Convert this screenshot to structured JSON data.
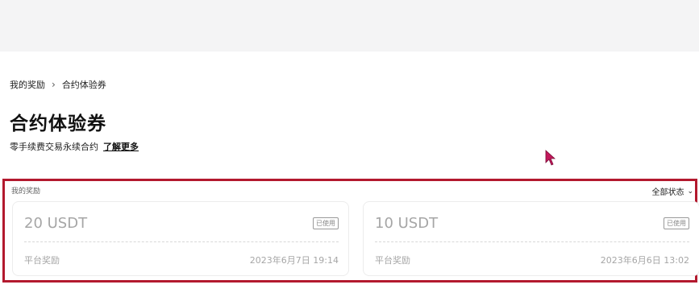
{
  "breadcrumb": {
    "parent": "我的奖励",
    "separator": "›",
    "current": "合约体验券"
  },
  "page": {
    "title": "合约体验券",
    "subtitle": "零手续费交易永续合约",
    "learn_more": "了解更多"
  },
  "rewards": {
    "section_label": "我的奖励",
    "status_filter": "全部状态",
    "cards": [
      {
        "amount": "20 USDT",
        "badge": "已使用",
        "source": "平台奖励",
        "date": "2023年6月7日 19:14"
      },
      {
        "amount": "10 USDT",
        "badge": "已使用",
        "source": "平台奖励",
        "date": "2023年6月6日 13:02"
      }
    ]
  },
  "colors": {
    "highlight_border": "#b3192e",
    "cursor": "#c2185b"
  }
}
